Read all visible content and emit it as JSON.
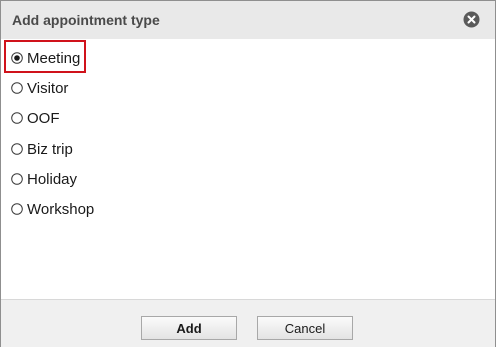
{
  "dialog": {
    "title": "Add appointment type",
    "close_icon": "close-circle-icon"
  },
  "options": [
    {
      "label": "Meeting",
      "selected": true
    },
    {
      "label": "Visitor",
      "selected": false
    },
    {
      "label": "OOF",
      "selected": false
    },
    {
      "label": "Biz trip",
      "selected": false
    },
    {
      "label": "Holiday",
      "selected": false
    },
    {
      "label": "Workshop",
      "selected": false
    }
  ],
  "footer": {
    "add_label": "Add",
    "cancel_label": "Cancel"
  },
  "colors": {
    "highlight": "#d0121b",
    "titlebar": "#e9e9e9"
  }
}
